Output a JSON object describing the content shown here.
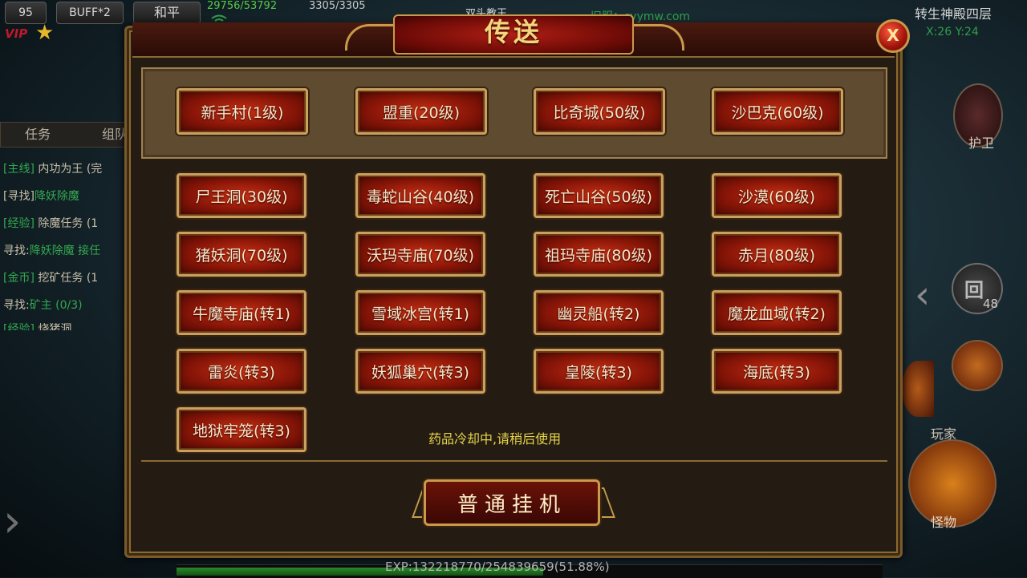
{
  "hud": {
    "level": "95",
    "buff": "BUFF*2",
    "mode": "和平",
    "vip": "VIP",
    "hp": "29756/53792",
    "mp": "3305/3305",
    "target": "双头教王",
    "site": "旧服：syymw.com",
    "map_name": "转生神殿四层",
    "coords": "X:26 Y:24",
    "guard_label": "护卫",
    "back_glyph": "回",
    "back_count": "48",
    "player_label": "玩家",
    "monster_label": "怪物",
    "exp_text": "EXP:132218770/254839659(51.88%)",
    "exp_percent": 51.88
  },
  "tasks": {
    "tabs": [
      "任务",
      "组队"
    ],
    "lines": [
      {
        "tag": "[主线]",
        "text": "内功为王 (完"
      },
      {
        "tag": "[寻找]",
        "text": "降妖除魔"
      },
      {
        "tag": "[经验]",
        "text": "除魔任务 (1"
      },
      {
        "tag": "寻找:",
        "text": "降妖除魔 接任"
      },
      {
        "tag": "[金币]",
        "text": "挖矿任务 (1"
      },
      {
        "tag": "寻找:",
        "text": "矿主 (0/3)"
      },
      {
        "tag": "[经验]",
        "text": "烧猪洞"
      }
    ]
  },
  "dialog": {
    "title": "传送",
    "close_label": "X",
    "top_destinations": [
      "新手村(1级)",
      "盟重(20级)",
      "比奇城(50级)",
      "沙巴克(60级)"
    ],
    "destinations": [
      [
        "尸王洞(30级)",
        "毒蛇山谷(40级)",
        "死亡山谷(50级)",
        "沙漠(60级)"
      ],
      [
        "猪妖洞(70级)",
        "沃玛寺庙(70级)",
        "祖玛寺庙(80级)",
        "赤月(80级)"
      ],
      [
        "牛魔寺庙(转1)",
        "雪域冰宫(转1)",
        "幽灵船(转2)",
        "魔龙血域(转2)"
      ],
      [
        "雷炎(转3)",
        "妖狐巢穴(转3)",
        "皇陵(转3)",
        "海底(转3)"
      ],
      [
        "地狱牢笼(转3)"
      ]
    ],
    "notice": "药品冷却中,请稍后使用",
    "hang_button": "普通挂机"
  }
}
